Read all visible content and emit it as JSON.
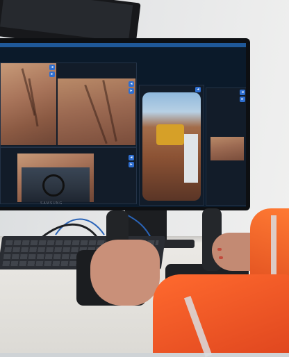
{
  "scene": {
    "description_label": "",
    "monitor_brand": "SAMSUNG"
  },
  "feeds": [
    {
      "id": "feed-1",
      "label": ""
    },
    {
      "id": "feed-2",
      "label": ""
    },
    {
      "id": "feed-3",
      "label": ""
    },
    {
      "id": "feed-4",
      "label": ""
    },
    {
      "id": "feed-5",
      "label": ""
    },
    {
      "id": "feed-6",
      "label": ""
    }
  ],
  "colors": {
    "screen_accent": "#2b7ad4",
    "vest": "#ff6a2e",
    "control_button": "#2f6fd0"
  },
  "icons": [
    "camera-control-icon",
    "joystick-icon"
  ]
}
